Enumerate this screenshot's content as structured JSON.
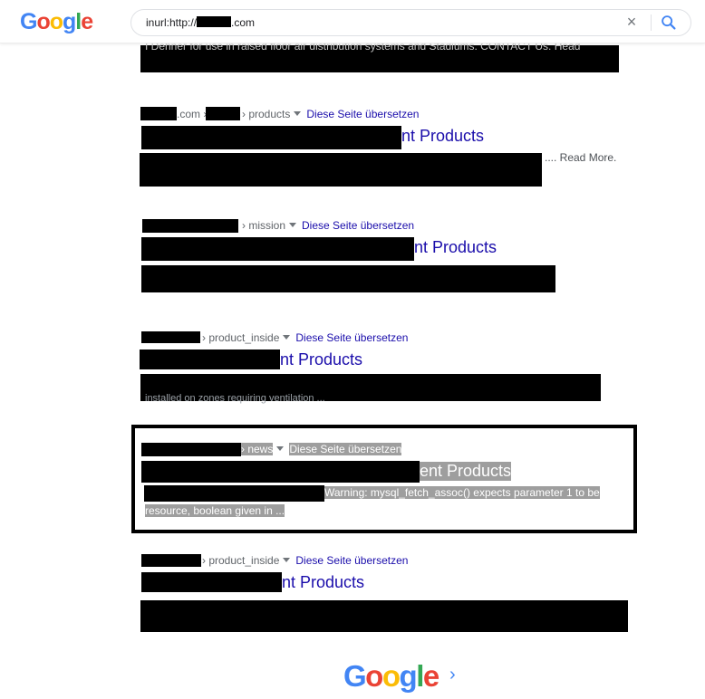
{
  "header": {
    "logo_letters": [
      "G",
      "o",
      "o",
      "g",
      "l",
      "e"
    ],
    "search_prefix": "inurl:http://",
    "search_suffix": ".com",
    "clear_icon": "×"
  },
  "top_snippet_fragment": "I Dehner for use in raised floor air distribution systems and Stadiums. CONTACT Us. Head",
  "results": [
    {
      "cite_domain": ".com",
      "cite_sep": "›",
      "cite_path": "› products",
      "translate": "Diese Seite übersetzen",
      "title_suffix": "nt Products",
      "snippet_tail": ".... Read More."
    },
    {
      "cite_path": "› mission",
      "translate": "Diese Seite übersetzen",
      "title_suffix": "nt Products"
    },
    {
      "cite_path": "› product_inside",
      "translate": "Diese Seite übersetzen",
      "title_suffix": "nt Products",
      "snippet_fragment": "installed on zones requiring ventilation ..."
    },
    {
      "cite_path": "› news",
      "translate": "Diese Seite übersetzen",
      "title_suffix": "ent Products",
      "snippet_line1": "Warning: mysql_fetch_assoc() expects parameter 1 to be",
      "snippet_line2": "resource, boolean given in ..."
    },
    {
      "cite_path": "› product_inside",
      "translate": "Diese Seite übersetzen",
      "title_suffix": "nt Products"
    }
  ],
  "footer": {
    "logo_letters": [
      "G",
      "o",
      "o",
      "g",
      "l",
      "e"
    ],
    "next_arrow": "›"
  },
  "colors": {
    "link": "#1a0dab",
    "cite": "#5f6368",
    "highlight": "#9e9e9e"
  }
}
